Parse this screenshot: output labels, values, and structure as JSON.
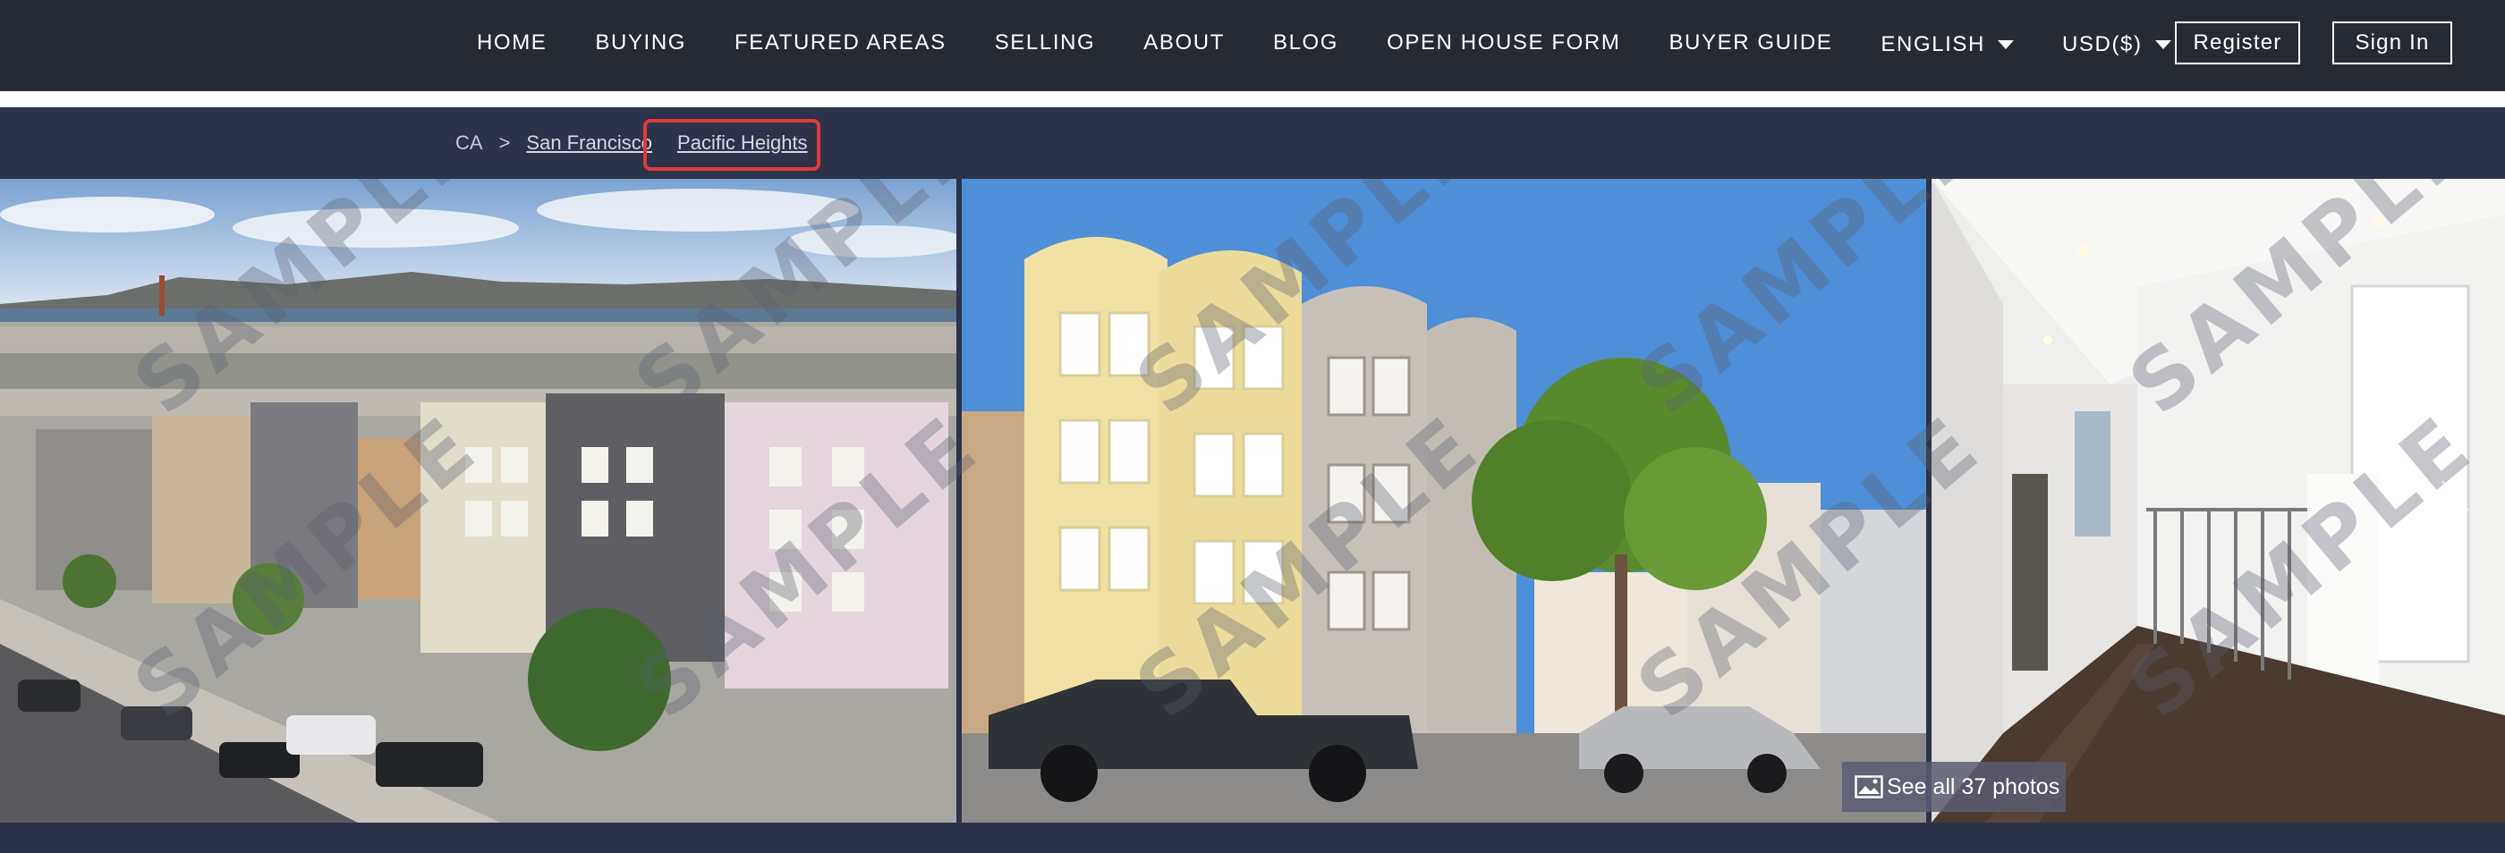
{
  "nav": {
    "items": [
      "HOME",
      "BUYING",
      "FEATURED AREAS",
      "SELLING",
      "ABOUT",
      "BLOG",
      "OPEN HOUSE FORM",
      "BUYER GUIDE"
    ],
    "language": "ENGLISH",
    "currency": "USD($)",
    "register_label": "Register",
    "signin_label": "Sign In"
  },
  "breadcrumb": {
    "state": "CA",
    "separator": ">",
    "city": "San Francisco",
    "neighborhood": "Pacific Heights"
  },
  "gallery": {
    "watermark": "SAMPLE",
    "see_all_label": "See all 37 photos"
  },
  "colors": {
    "nav_bg": "#262b33",
    "crumb_bg": "#2d3348",
    "highlight": "#e0393b"
  }
}
